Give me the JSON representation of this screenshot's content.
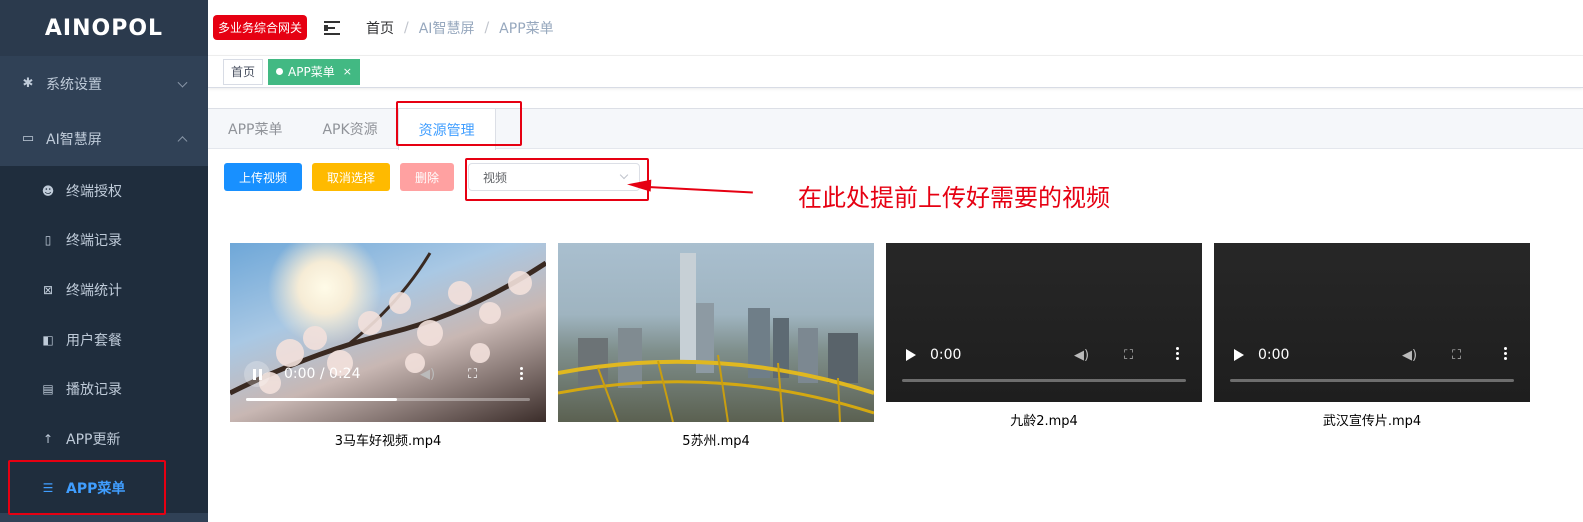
{
  "logo": "AINOPOL",
  "sidebar": {
    "groups": [
      {
        "label": "系统设置",
        "icon": "gear-icon"
      },
      {
        "label": "AI智慧屏",
        "icon": "monitor-icon"
      }
    ],
    "items": [
      {
        "label": "终端授权",
        "icon": "robot-icon"
      },
      {
        "label": "终端记录",
        "icon": "document-icon"
      },
      {
        "label": "终端统计",
        "icon": "calendar-icon"
      },
      {
        "label": "用户套餐",
        "icon": "package-icon"
      },
      {
        "label": "播放记录",
        "icon": "log-icon"
      },
      {
        "label": "APP更新",
        "icon": "arrow-up-icon"
      },
      {
        "label": "APP菜单",
        "icon": "list-icon"
      }
    ]
  },
  "header": {
    "badge": "多业务综合网关",
    "breadcrumb": [
      "首页",
      "AI智慧屏",
      "APP菜单"
    ],
    "separator": "/"
  },
  "tagsbar": {
    "tags": [
      "首页",
      "APP菜单"
    ],
    "close": "×"
  },
  "tabs": [
    "APP菜单",
    "APK资源",
    "资源管理"
  ],
  "toolbar": {
    "upload": "上传视频",
    "cancel": "取消选择",
    "delete": "删除",
    "select_value": "视频"
  },
  "annotation": "在此处提前上传好需要的视频",
  "videos": [
    {
      "name": "3马车好视频.mp4",
      "time": "0:00 / 0:24",
      "state": "playing",
      "progress": 0.53
    },
    {
      "name": "5苏州.mp4",
      "time": "",
      "state": "poster"
    },
    {
      "name": "九龄2.mp4",
      "time": "0:00",
      "state": "paused"
    },
    {
      "name": "武汉宣传片.mp4",
      "time": "0:00",
      "state": "paused"
    }
  ],
  "colors": {
    "sidebar": "#304156",
    "active": "#409eff",
    "annotation": "#e60012",
    "tag_active": "#42b983"
  }
}
